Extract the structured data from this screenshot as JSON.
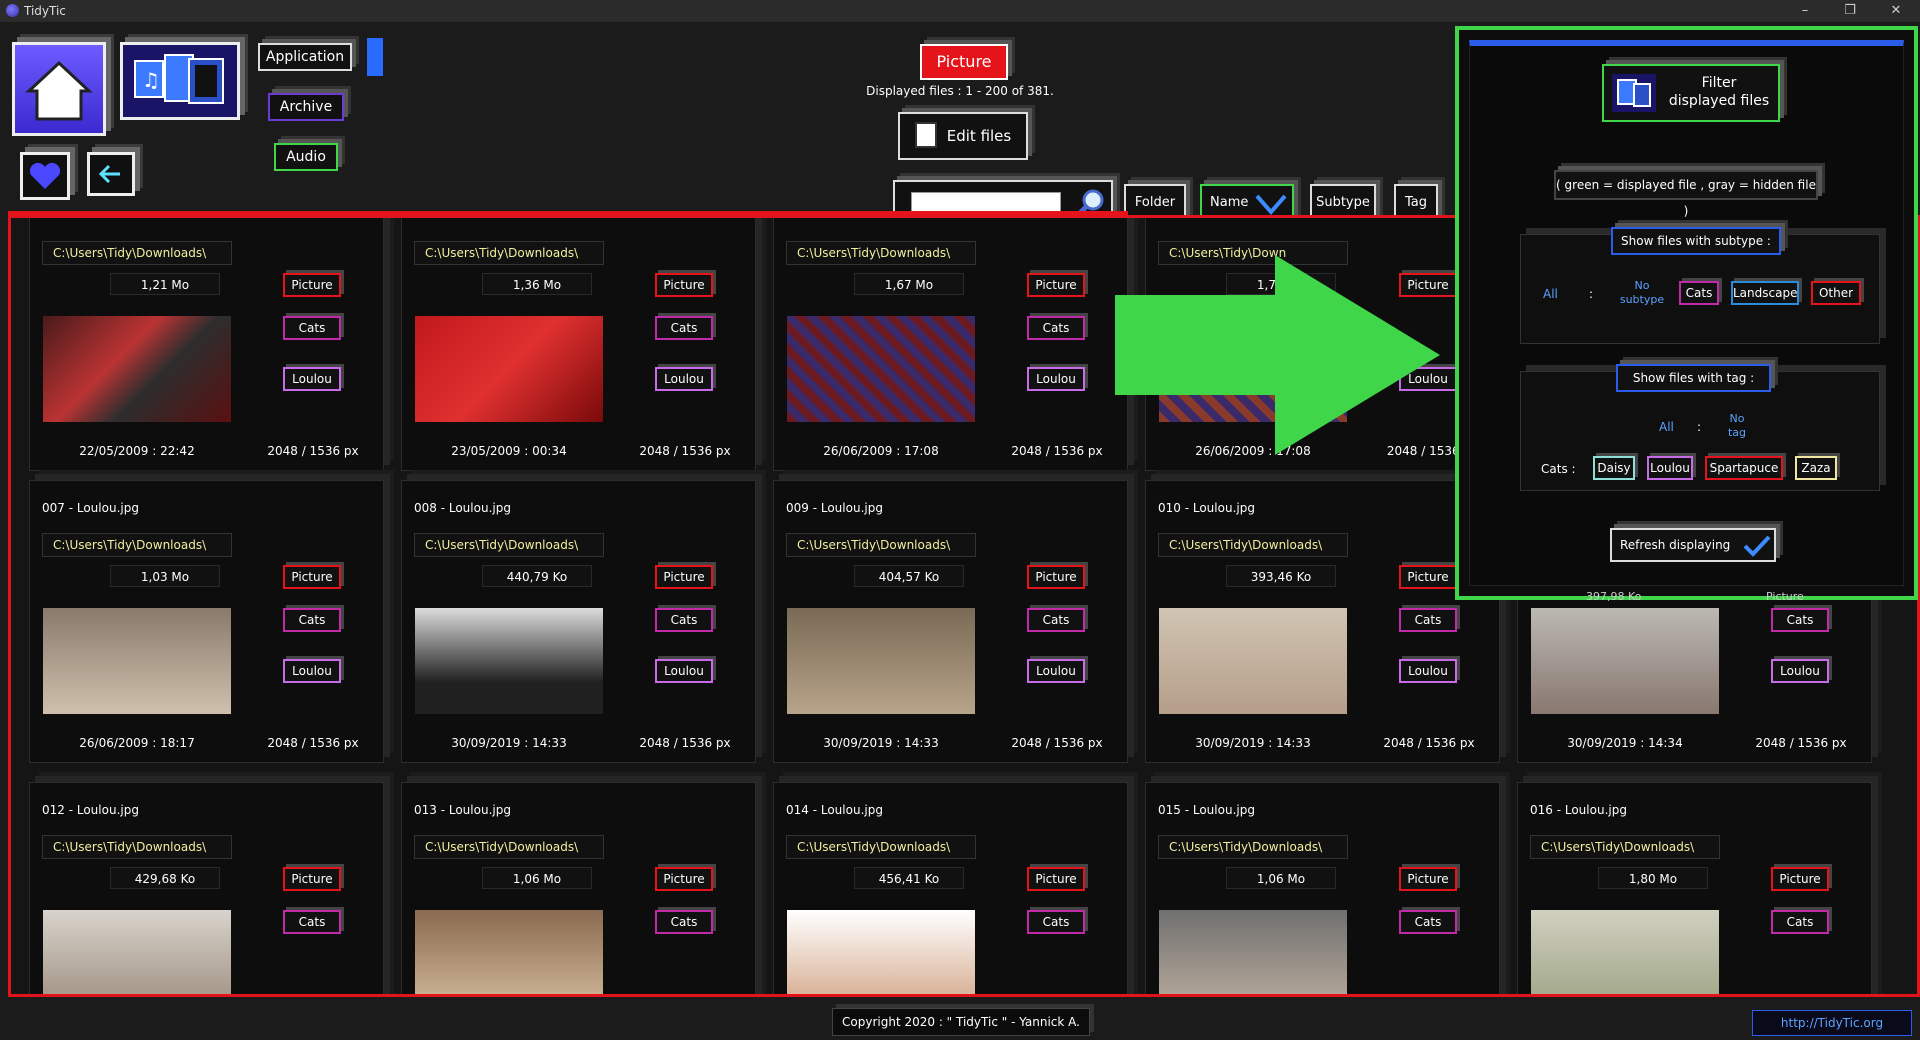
{
  "window": {
    "title": "TidyTic",
    "controls": [
      "–",
      "❐",
      "✕"
    ]
  },
  "top_nav": {
    "application": "Application",
    "archive": "Archive",
    "audio": "Audio"
  },
  "header": {
    "type_label": "Picture",
    "displayed_files": "Displayed files : 1 - 200 of 381.",
    "edit_files": "Edit files"
  },
  "search": {
    "value": "",
    "placeholder": ""
  },
  "sort_buttons": {
    "folder": "Folder",
    "name": "Name",
    "subtype": "Subtype",
    "tag": "Tag"
  },
  "cards": [
    {
      "name": "",
      "path": "C:\\Users\\Tidy\\Downloads\\",
      "size": "1,21 Mo",
      "date": "22/05/2009 : 22:42",
      "res": "2048 / 1536 px",
      "subtype": "Picture",
      "cat": "Cats",
      "tag": "Loulou"
    },
    {
      "name": "",
      "path": "C:\\Users\\Tidy\\Downloads\\",
      "size": "1,36 Mo",
      "date": "23/05/2009 : 00:34",
      "res": "2048 / 1536 px",
      "subtype": "Picture",
      "cat": "Cats",
      "tag": "Loulou"
    },
    {
      "name": "",
      "path": "C:\\Users\\Tidy\\Downloads\\",
      "size": "1,67 Mo",
      "date": "26/06/2009 : 17:08",
      "res": "2048 / 1536 px",
      "subtype": "Picture",
      "cat": "Cats",
      "tag": "Loulou"
    },
    {
      "name": "",
      "path": "C:\\Users\\Tidy\\Down",
      "size": "1,77 Mo",
      "date": "26/06/2009 : 17:08",
      "res": "2048 / 1536 p",
      "subtype": "Picture",
      "cat": "",
      "tag": "Loulou"
    },
    {
      "name": "007 - Loulou.jpg",
      "path": "C:\\Users\\Tidy\\Downloads\\",
      "size": "1,03 Mo",
      "date": "26/06/2009 : 18:17",
      "res": "2048 / 1536 px",
      "subtype": "Picture",
      "cat": "Cats",
      "tag": "Loulou"
    },
    {
      "name": "008 - Loulou.jpg",
      "path": "C:\\Users\\Tidy\\Downloads\\",
      "size": "440,79 Ko",
      "date": "30/09/2019 : 14:33",
      "res": "2048 / 1536 px",
      "subtype": "Picture",
      "cat": "Cats",
      "tag": "Loulou"
    },
    {
      "name": "009 - Loulou.jpg",
      "path": "C:\\Users\\Tidy\\Downloads\\",
      "size": "404,57 Ko",
      "date": "30/09/2019 : 14:33",
      "res": "2048 / 1536 px",
      "subtype": "Picture",
      "cat": "Cats",
      "tag": "Loulou"
    },
    {
      "name": "010 - Loulou.jpg",
      "path": "C:\\Users\\Tidy\\Downloads\\",
      "size": "393,46 Ko",
      "date": "30/09/2019 : 14:33",
      "res": "2048 / 1536 px",
      "subtype": "Picture",
      "cat": "Cats",
      "tag": "Loulou"
    },
    {
      "name": "",
      "path": "",
      "size": "",
      "date": "30/09/2019 : 14:34",
      "res": "2048 / 1536 px",
      "subtype": "Picture",
      "cat": "Cats",
      "tag": "Loulou"
    },
    {
      "name": "012 - Loulou.jpg",
      "path": "C:\\Users\\Tidy\\Downloads\\",
      "size": "429,68 Ko",
      "date": "",
      "res": "",
      "subtype": "Picture",
      "cat": "Cats",
      "tag": ""
    },
    {
      "name": "013 - Loulou.jpg",
      "path": "C:\\Users\\Tidy\\Downloads\\",
      "size": "1,06 Mo",
      "date": "",
      "res": "",
      "subtype": "Picture",
      "cat": "Cats",
      "tag": ""
    },
    {
      "name": "014 - Loulou.jpg",
      "path": "C:\\Users\\Tidy\\Downloads\\",
      "size": "456,41 Ko",
      "date": "",
      "res": "",
      "subtype": "Picture",
      "cat": "Cats",
      "tag": ""
    },
    {
      "name": "015 - Loulou.jpg",
      "path": "C:\\Users\\Tidy\\Downloads\\",
      "size": "1,06 Mo",
      "date": "",
      "res": "",
      "subtype": "Picture",
      "cat": "Cats",
      "tag": ""
    },
    {
      "name": "016 - Loulou.jpg",
      "path": "C:\\Users\\Tidy\\Downloads\\",
      "size": "1,80 Mo",
      "date": "",
      "res": "",
      "subtype": "Picture",
      "cat": "Cats",
      "tag": ""
    }
  ],
  "filter": {
    "title_line1": "Filter",
    "title_line2": "displayed files",
    "legend": "( green = displayed file , gray = hidden file )",
    "subtype_heading": "Show files with subtype :",
    "subtype_all": "All",
    "colon": ":",
    "no_subtype_1": "No",
    "no_subtype_2": "subtype",
    "subtypes": [
      "Cats",
      "Landscape",
      "Other"
    ],
    "tag_heading": "Show files with tag :",
    "tag_all": "All",
    "no_tag_1": "No",
    "no_tag_2": "tag",
    "tag_group_label": "Cats :",
    "tags": [
      "Daisy",
      "Loulou",
      "Spartapuce",
      "Zaza"
    ],
    "refresh": "Refresh displaying",
    "peek_size": "397,98 Ko",
    "peek_tag": "Picture"
  },
  "footer": {
    "copyright": "Copyright 2020 : \" TidyTic \" - Yannick A.",
    "link": "http://TidyTic.org"
  },
  "colors": {
    "accent_red": "#e5131a",
    "accent_green": "#3fd64a",
    "accent_blue": "#2a5dea"
  }
}
